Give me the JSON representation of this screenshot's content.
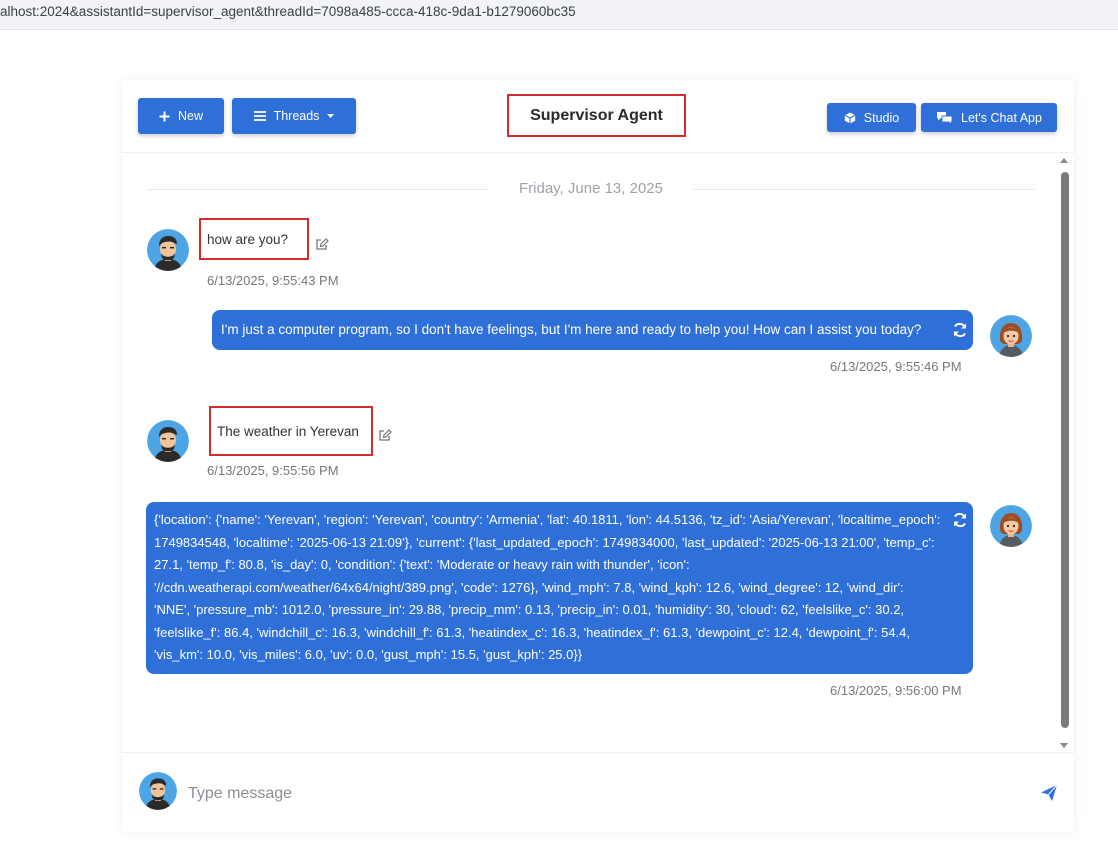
{
  "browser": {
    "url": "alhost:2024&assistantId=supervisor_agent&threadId=7098a485-ccca-418c-9da1-b1279060bc35"
  },
  "header": {
    "new_label": "New",
    "threads_label": "Threads",
    "title": "Supervisor Agent",
    "studio_label": "Studio",
    "chat_app_label": "Let's Chat App"
  },
  "chat": {
    "date": "Friday, June 13, 2025",
    "messages": [
      {
        "role": "user",
        "text": "how are you?",
        "time": "6/13/2025, 9:55:43 PM"
      },
      {
        "role": "assistant",
        "text": "I'm just a computer program, so I don't have feelings, but I'm here and ready to help you! How can I assist you today?",
        "time": "6/13/2025, 9:55:46 PM"
      },
      {
        "role": "user",
        "text": "The weather in Yerevan",
        "time": "6/13/2025, 9:55:56 PM"
      },
      {
        "role": "assistant",
        "text": "{'location': {'name': 'Yerevan', 'region': 'Yerevan', 'country': 'Armenia', 'lat': 40.1811, 'lon': 44.5136, 'tz_id': 'Asia/Yerevan', 'localtime_epoch': 1749834548, 'localtime': '2025-06-13 21:09'}, 'current': {'last_updated_epoch': 1749834000, 'last_updated': '2025-06-13 21:00', 'temp_c': 27.1, 'temp_f': 80.8, 'is_day': 0, 'condition': {'text': 'Moderate or heavy rain with thunder', 'icon': '//cdn.weatherapi.com/weather/64x64/night/389.png', 'code': 1276}, 'wind_mph': 7.8, 'wind_kph': 12.6, 'wind_degree': 12, 'wind_dir': 'NNE', 'pressure_mb': 1012.0, 'pressure_in': 29.88, 'precip_mm': 0.13, 'precip_in': 0.01, 'humidity': 30, 'cloud': 62, 'feelslike_c': 30.2, 'feelslike_f': 86.4, 'windchill_c': 16.3, 'windchill_f': 61.3, 'heatindex_c': 16.3, 'heatindex_f': 61.3, 'dewpoint_c': 12.4, 'dewpoint_f': 54.4, 'vis_km': 10.0, 'vis_miles': 6.0, 'uv': 0.0, 'gust_mph': 15.5, 'gust_kph': 25.0}}",
        "time": "6/13/2025, 9:56:00 PM"
      }
    ]
  },
  "composer": {
    "placeholder": "Type message"
  },
  "colors": {
    "accent": "#2f6fd8",
    "highlight_border": "#d62b2b"
  },
  "icons": {
    "new": "plus-icon",
    "threads": "menu-icon",
    "studio": "cube-icon",
    "chat_app": "chat-bubbles-icon",
    "edit": "edit-icon",
    "regenerate": "refresh-icon",
    "send": "send-icon"
  }
}
